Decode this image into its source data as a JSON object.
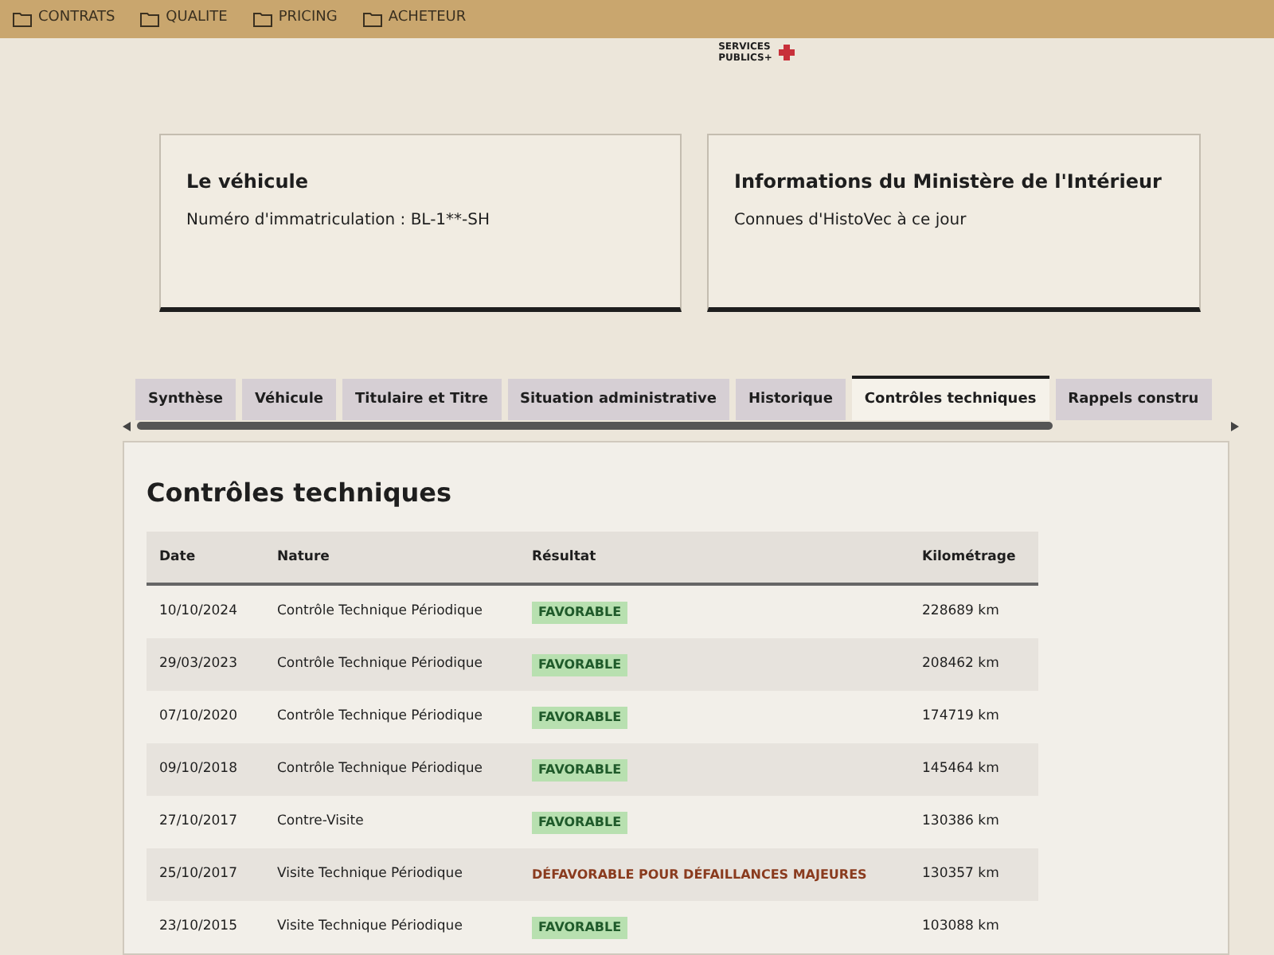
{
  "bookmarks": [
    {
      "label": "CONTRATS"
    },
    {
      "label": "QUALITE"
    },
    {
      "label": "PRICING"
    },
    {
      "label": "ACHETEUR"
    }
  ],
  "logo": {
    "lines": [
      "SERVICES",
      "PUBLICS+"
    ]
  },
  "cards": [
    {
      "title": "Le véhicule",
      "text": "Numéro d'immatriculation : BL-1**-SH"
    },
    {
      "title": "Informations du Ministère de l'Intérieur",
      "text": "Connues d'HistoVec à ce jour"
    }
  ],
  "tabs": [
    {
      "label": "Synthèse",
      "selected": false
    },
    {
      "label": "Véhicule",
      "selected": false
    },
    {
      "label": "Titulaire et Titre",
      "selected": false
    },
    {
      "label": "Situation administrative",
      "selected": false
    },
    {
      "label": "Historique",
      "selected": false
    },
    {
      "label": "Contrôles techniques",
      "selected": true
    },
    {
      "label": "Rappels constru",
      "selected": false
    }
  ],
  "section": {
    "title": "Contrôles techniques"
  },
  "table": {
    "columns": [
      "Date",
      "Nature",
      "Résultat",
      "Kilométrage"
    ],
    "rows": [
      {
        "date": "10/10/2024",
        "nature": "Contrôle Technique Périodique",
        "result": "FAVORABLE",
        "kind": "favorable",
        "km": "228689 km"
      },
      {
        "date": "29/03/2023",
        "nature": "Contrôle Technique Périodique",
        "result": "FAVORABLE",
        "kind": "favorable",
        "km": "208462 km"
      },
      {
        "date": "07/10/2020",
        "nature": "Contrôle Technique Périodique",
        "result": "FAVORABLE",
        "kind": "favorable",
        "km": "174719 km"
      },
      {
        "date": "09/10/2018",
        "nature": "Contrôle Technique Périodique",
        "result": "FAVORABLE",
        "kind": "favorable",
        "km": "145464 km"
      },
      {
        "date": "27/10/2017",
        "nature": "Contre-Visite",
        "result": "FAVORABLE",
        "kind": "favorable",
        "km": "130386 km"
      },
      {
        "date": "25/10/2017",
        "nature": "Visite Technique Périodique",
        "result": "DÉFAVORABLE POUR DÉFAILLANCES MAJEURES",
        "kind": "defavorable",
        "km": "130357 km"
      },
      {
        "date": "23/10/2015",
        "nature": "Visite Technique Périodique",
        "result": "FAVORABLE",
        "kind": "favorable",
        "km": "103088 km"
      }
    ]
  }
}
